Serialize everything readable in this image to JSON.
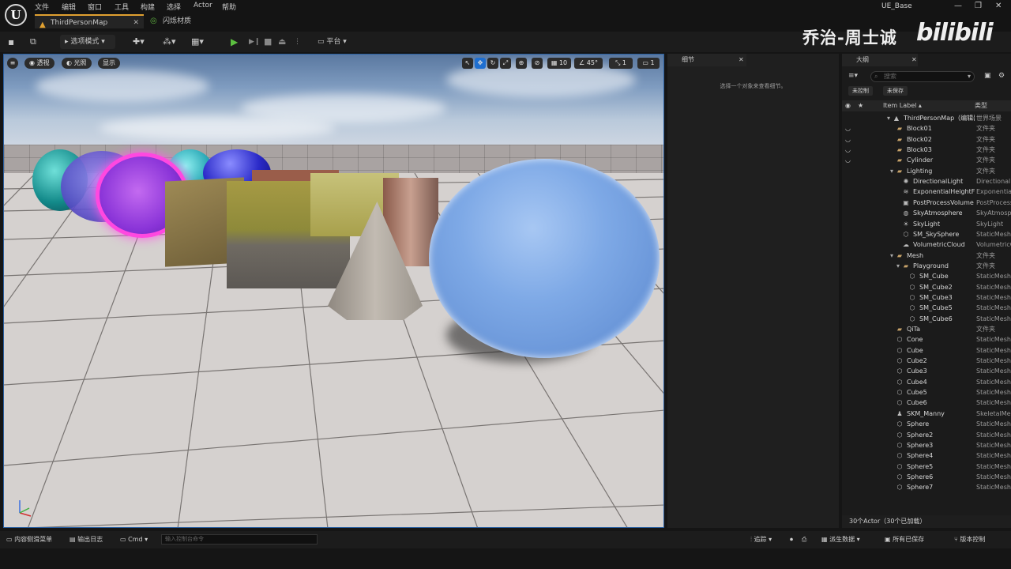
{
  "app": {
    "title": "UE_Base",
    "logo": "U"
  },
  "menus": [
    "文件",
    "编辑",
    "窗口",
    "工具",
    "构建",
    "选择",
    "Actor",
    "帮助"
  ],
  "tabs": [
    {
      "label": "ThirdPersonMap",
      "close": "✕"
    },
    {
      "label": "闪烁材质"
    }
  ],
  "window_controls": {
    "minimize": "—",
    "maximize": "❐",
    "close": "✕"
  },
  "watermark": {
    "author": "乔治-周士诚",
    "brand": "bilibili"
  },
  "toolbar": {
    "select_mode": "选项模式",
    "platform": "平台"
  },
  "viewport": {
    "menu_icon": "≡",
    "perspective": "透视",
    "lighting": "光照",
    "show": "显示",
    "grid_value": "10",
    "angle_value": "45°",
    "scale_value": "1",
    "camera_speed": "1"
  },
  "details": {
    "title": "细节",
    "hint": "选择一个对象来查看细节。",
    "close": "✕"
  },
  "outliner": {
    "title": "大纲",
    "close": "✕",
    "search_placeholder": "搜索",
    "chips": [
      "未控制",
      "未保存"
    ],
    "col_label": "Item Label ▴",
    "col_type": "类型",
    "rows": [
      {
        "label": "ThirdPersonMap（编辑器）",
        "type": "世界场景",
        "indent": 0,
        "icon": "level",
        "eye": false
      },
      {
        "label": "Block01",
        "type": "文件夹",
        "indent": 1,
        "icon": "folder",
        "eye": true
      },
      {
        "label": "Block02",
        "type": "文件夹",
        "indent": 1,
        "icon": "folder",
        "eye": true
      },
      {
        "label": "Block03",
        "type": "文件夹",
        "indent": 1,
        "icon": "folder",
        "eye": true
      },
      {
        "label": "Cylinder",
        "type": "文件夹",
        "indent": 1,
        "icon": "folder",
        "eye": true
      },
      {
        "label": "Lighting",
        "type": "文件夹",
        "indent": 1,
        "icon": "folder-open",
        "eye": false
      },
      {
        "label": "DirectionalLight",
        "type": "DirectionalLight",
        "indent": 2,
        "icon": "light",
        "eye": false
      },
      {
        "label": "ExponentialHeightFog",
        "type": "ExponentialHeightFog",
        "indent": 2,
        "icon": "fog",
        "eye": false
      },
      {
        "label": "PostProcessVolume",
        "type": "PostProcessVolume",
        "indent": 2,
        "icon": "volume",
        "eye": false
      },
      {
        "label": "SkyAtmosphere",
        "type": "SkyAtmosphere",
        "indent": 2,
        "icon": "sky",
        "eye": false
      },
      {
        "label": "SkyLight",
        "type": "SkyLight",
        "indent": 2,
        "icon": "skylight",
        "eye": false
      },
      {
        "label": "SM_SkySphere",
        "type": "StaticMeshActor",
        "indent": 2,
        "icon": "mesh",
        "eye": false
      },
      {
        "label": "VolumetricCloud",
        "type": "VolumetricCloud",
        "indent": 2,
        "icon": "cloud",
        "eye": false
      },
      {
        "label": "Mesh",
        "type": "文件夹",
        "indent": 1,
        "icon": "folder-open",
        "eye": false
      },
      {
        "label": "Playground",
        "type": "文件夹",
        "indent": 2,
        "icon": "folder-open",
        "eye": false
      },
      {
        "label": "SM_Cube",
        "type": "StaticMeshActor",
        "indent": 3,
        "icon": "mesh",
        "eye": false
      },
      {
        "label": "SM_Cube2",
        "type": "StaticMeshActor",
        "indent": 3,
        "icon": "mesh",
        "eye": false
      },
      {
        "label": "SM_Cube3",
        "type": "StaticMeshActor",
        "indent": 3,
        "icon": "mesh",
        "eye": false
      },
      {
        "label": "SM_Cube5",
        "type": "StaticMeshActor",
        "indent": 3,
        "icon": "mesh",
        "eye": false
      },
      {
        "label": "SM_Cube6",
        "type": "StaticMeshActor",
        "indent": 3,
        "icon": "mesh",
        "eye": false
      },
      {
        "label": "QiTa",
        "type": "文件夹",
        "indent": 1,
        "icon": "folder",
        "eye": false
      },
      {
        "label": "Cone",
        "type": "StaticMeshActor",
        "indent": 1,
        "icon": "mesh",
        "eye": false
      },
      {
        "label": "Cube",
        "type": "StaticMeshActor",
        "indent": 1,
        "icon": "mesh",
        "eye": false
      },
      {
        "label": "Cube2",
        "type": "StaticMeshActor",
        "indent": 1,
        "icon": "mesh",
        "eye": false
      },
      {
        "label": "Cube3",
        "type": "StaticMeshActor",
        "indent": 1,
        "icon": "mesh",
        "eye": false
      },
      {
        "label": "Cube4",
        "type": "StaticMeshActor",
        "indent": 1,
        "icon": "mesh",
        "eye": false
      },
      {
        "label": "Cube5",
        "type": "StaticMeshActor",
        "indent": 1,
        "icon": "mesh",
        "eye": false
      },
      {
        "label": "Cube6",
        "type": "StaticMeshActor",
        "indent": 1,
        "icon": "mesh",
        "eye": false
      },
      {
        "label": "SKM_Manny",
        "type": "SkeletalMeshActor",
        "indent": 1,
        "icon": "skeletal",
        "eye": false
      },
      {
        "label": "Sphere",
        "type": "StaticMeshActor",
        "indent": 1,
        "icon": "mesh",
        "eye": false
      },
      {
        "label": "Sphere2",
        "type": "StaticMeshActor",
        "indent": 1,
        "icon": "mesh",
        "eye": false
      },
      {
        "label": "Sphere3",
        "type": "StaticMeshActor",
        "indent": 1,
        "icon": "mesh",
        "eye": false
      },
      {
        "label": "Sphere4",
        "type": "StaticMeshActor",
        "indent": 1,
        "icon": "mesh",
        "eye": false
      },
      {
        "label": "Sphere5",
        "type": "StaticMeshActor",
        "indent": 1,
        "icon": "mesh",
        "eye": false
      },
      {
        "label": "Sphere6",
        "type": "StaticMeshActor",
        "indent": 1,
        "icon": "mesh",
        "eye": false
      },
      {
        "label": "Sphere7",
        "type": "StaticMeshActor",
        "indent": 1,
        "icon": "mesh",
        "eye": false
      }
    ],
    "count": "30个Actor（30个已加载）"
  },
  "statusbar": {
    "content_drawer": "内容侧滑菜单",
    "output_log": "输出日志",
    "cmd": "Cmd",
    "cmd_placeholder": "输入控制台命令",
    "trace": "追踪",
    "derived_data": "派生数据",
    "all_saved": "所有已保存",
    "source_control": "版本控制"
  },
  "colors": {
    "accent_orange": "#e0a030",
    "play_green": "#5cc040",
    "viewport_border": "#2a5fa0",
    "folder": "#c8a36a"
  }
}
